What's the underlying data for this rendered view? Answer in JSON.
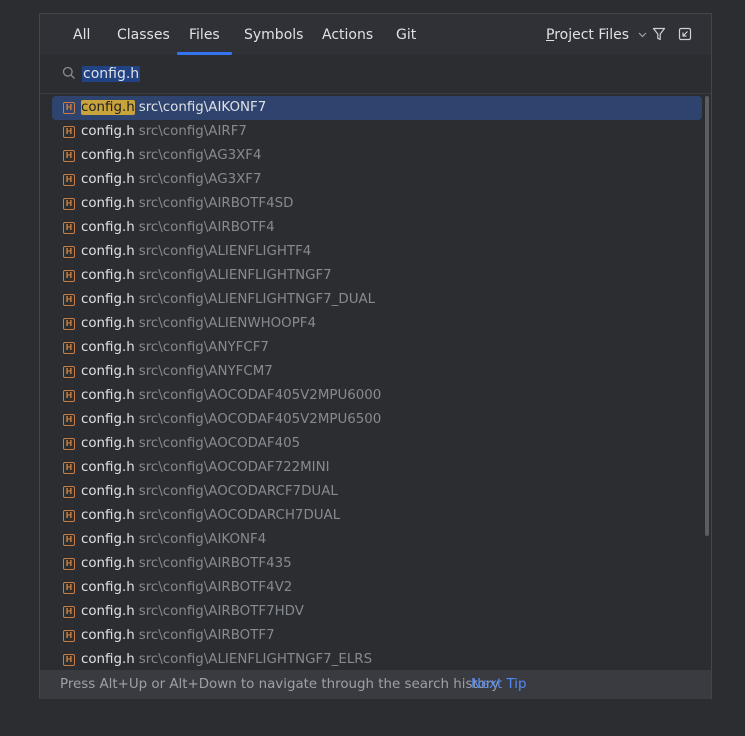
{
  "tabs": [
    {
      "label": "All"
    },
    {
      "label": "Classes"
    },
    {
      "label": "Files",
      "active": true
    },
    {
      "label": "Symbols"
    },
    {
      "label": "Actions"
    },
    {
      "label": "Git"
    }
  ],
  "scope": {
    "first": "P",
    "rest": "roject Files"
  },
  "icons": {
    "filter": "filter-icon",
    "preview": "open-in-window-icon",
    "search": "search-icon",
    "file": "header-file-icon",
    "chevron": "chevron-down-icon"
  },
  "search": {
    "value": "config.h"
  },
  "results": [
    {
      "name": "config.h",
      "path": "src\\config\\AIKONF7",
      "selected": true
    },
    {
      "name": "config.h",
      "path": "src\\config\\AIRF7"
    },
    {
      "name": "config.h",
      "path": "src\\config\\AG3XF4"
    },
    {
      "name": "config.h",
      "path": "src\\config\\AG3XF7"
    },
    {
      "name": "config.h",
      "path": "src\\config\\AIRBOTF4SD"
    },
    {
      "name": "config.h",
      "path": "src\\config\\AIRBOTF4"
    },
    {
      "name": "config.h",
      "path": "src\\config\\ALIENFLIGHTF4"
    },
    {
      "name": "config.h",
      "path": "src\\config\\ALIENFLIGHTNGF7"
    },
    {
      "name": "config.h",
      "path": "src\\config\\ALIENFLIGHTNGF7_DUAL"
    },
    {
      "name": "config.h",
      "path": "src\\config\\ALIENWHOOPF4"
    },
    {
      "name": "config.h",
      "path": "src\\config\\ANYFCF7"
    },
    {
      "name": "config.h",
      "path": "src\\config\\ANYFCM7"
    },
    {
      "name": "config.h",
      "path": "src\\config\\AOCODAF405V2MPU6000"
    },
    {
      "name": "config.h",
      "path": "src\\config\\AOCODAF405V2MPU6500"
    },
    {
      "name": "config.h",
      "path": "src\\config\\AOCODAF405"
    },
    {
      "name": "config.h",
      "path": "src\\config\\AOCODAF722MINI"
    },
    {
      "name": "config.h",
      "path": "src\\config\\AOCODARCF7DUAL"
    },
    {
      "name": "config.h",
      "path": "src\\config\\AOCODARCH7DUAL"
    },
    {
      "name": "config.h",
      "path": "src\\config\\AIKONF4"
    },
    {
      "name": "config.h",
      "path": "src\\config\\AIRBOTF435"
    },
    {
      "name": "config.h",
      "path": "src\\config\\AIRBOTF4V2"
    },
    {
      "name": "config.h",
      "path": "src\\config\\AIRBOTF7HDV"
    },
    {
      "name": "config.h",
      "path": "src\\config\\AIRBOTF7"
    },
    {
      "name": "config.h",
      "path": "src\\config\\ALIENFLIGHTNGF7_ELRS"
    }
  ],
  "footer": {
    "hint": "Press Alt+Up or Alt+Down to navigate through the search history",
    "next_tip": "Next Tip"
  },
  "colors": {
    "accent": "#3574f0",
    "selection": "#2e436e",
    "highlight": "#c9a43b",
    "link": "#548af7"
  }
}
